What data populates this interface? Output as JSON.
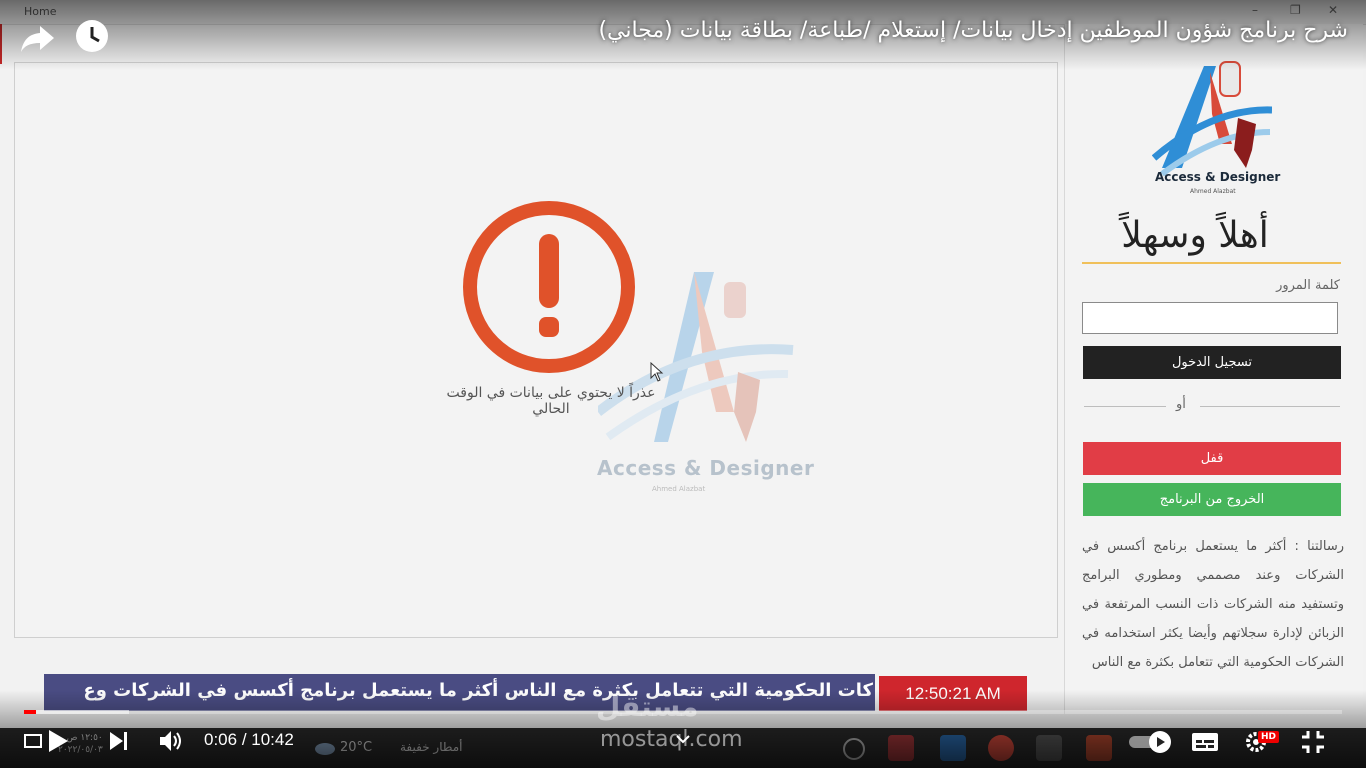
{
  "window": {
    "title": "Home"
  },
  "video": {
    "title": "شرح برنامج شؤون الموظفين إدخال بيانات/ إستعلام /طباعة/ بطاقة بيانات (مجاني)",
    "current_time": "0:06",
    "separator": " / ",
    "duration": "10:42",
    "progress_fraction": 0.0094,
    "buffered_fraction": 0.08,
    "hd_badge": "HD"
  },
  "main": {
    "empty_message": "عذراً لا يحتوي على بيانات في الوقت الحالي",
    "watermark_title": "Access & Designer",
    "watermark_sub": "Ahmed Alazbat"
  },
  "sidebar": {
    "logo_title": "Access & Designer",
    "logo_sub": "Ahmed Alazbat",
    "welcome": "أهلاً وسهلاً",
    "password_label": "كلمة المرور",
    "password_value": "",
    "login_button": "تسجيل الدخول",
    "or_text": "أو",
    "lock_button": "قفل",
    "exit_button": "الخروج من البرنامج",
    "message": "رسالتنا : أكثر ما يستعمل برنامج أكسس في الشركات وعند مصممي ومطوري البرامج وتستفيد منه الشركات ذات النسب المرتفعة في الزبائن لإدارة سجلاتهم وأيضا يكثر استخدامه في الشركات الحكومية التي تتعامل بكثرة مع الناس"
  },
  "ticker": {
    "text": "كات الحكومية التي تتعامل بكثرة مع الناس   أكثر ما يستعمل برنامج أكسس في الشركات وع",
    "clock": "12:50:21 AM"
  },
  "taskbar": {
    "temperature": "20°C",
    "weather": "أمطار خفيفة",
    "time": "١٢:٥٠ ص",
    "date": "٢٠٢٢/٠٥/٠٣"
  },
  "overlay_watermark": {
    "arabic": "مستقل",
    "latin": "mostaql.com"
  },
  "colors": {
    "login_button": "#222222",
    "lock_button": "#e13d46",
    "exit_button": "#46b55b",
    "ticker_bg": "#4a4c83",
    "clock_bg": "#cf262d",
    "warning": "#e0522a",
    "progress": "#ff0000"
  }
}
